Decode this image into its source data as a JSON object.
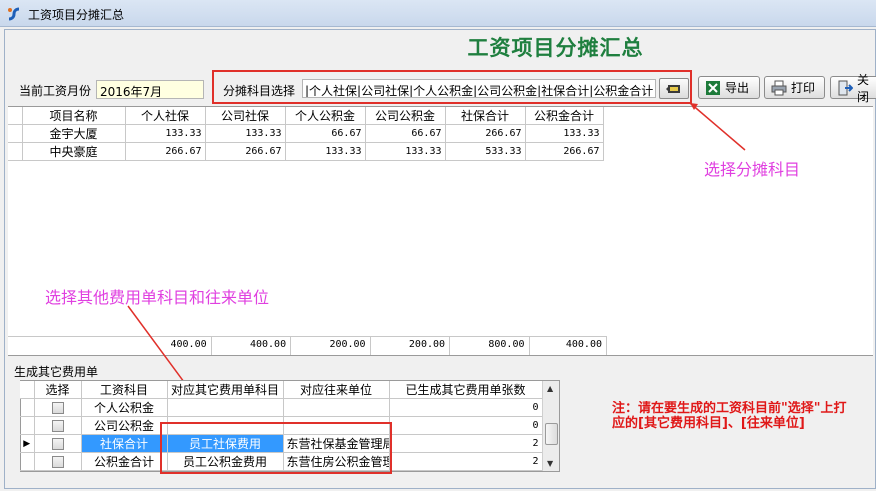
{
  "window": {
    "title": "工资项目分摊汇总",
    "heading": "工资项目分摊汇总"
  },
  "toolbar": {
    "month_label": "当前工资月份",
    "month_value": "2016年7月",
    "subject_label": "分摊科目选择",
    "subject_value": "|个人社保|公司社保|个人公积金|公司公积金|社保合计|公积金合计",
    "export_label": "导出",
    "print_label": "打印",
    "close_label": "关闭"
  },
  "main_grid": {
    "columns": [
      "项目名称",
      "个人社保",
      "公司社保",
      "个人公积金",
      "公司公积金",
      "社保合计",
      "公积金合计"
    ],
    "rows": [
      [
        "金宇大厦",
        "133.33",
        "133.33",
        "66.67",
        "66.67",
        "266.67",
        "133.33"
      ],
      [
        "中央豪庭",
        "266.67",
        "266.67",
        "133.33",
        "133.33",
        "533.33",
        "266.67"
      ]
    ],
    "totals": [
      "400.00",
      "400.00",
      "200.00",
      "200.00",
      "800.00",
      "400.00"
    ]
  },
  "annotations": {
    "select_subject": "选择分摊科目",
    "select_other": "选择其他费用单科目和往来单位",
    "note_line1": "注：请在要生成的工资科目前\"选择\"上打",
    "note_line2": "应的[其它费用科目]、[往来单位]"
  },
  "sub_section": {
    "label": "生成其它费用单",
    "columns": [
      "选择",
      "工资科目",
      "对应其它费用单科目",
      "对应往来单位",
      "已生成其它费用单张数"
    ],
    "rows": [
      {
        "item": "个人公积金",
        "expense": "",
        "unit": "",
        "count": "0"
      },
      {
        "item": "公司公积金",
        "expense": "",
        "unit": "",
        "count": "0"
      },
      {
        "item": "社保合计",
        "expense": "员工社保费用",
        "unit": "东营社保基金管理局",
        "count": "2"
      },
      {
        "item": "公积金合计",
        "expense": "员工公积金费用",
        "unit": "东营住房公积金管理中心",
        "count": "2"
      }
    ]
  },
  "colors": {
    "heading": "#1f7f3f",
    "annotation": "#e040e0",
    "highlight_box": "#e0302a",
    "selected_row": "#3399ff"
  }
}
